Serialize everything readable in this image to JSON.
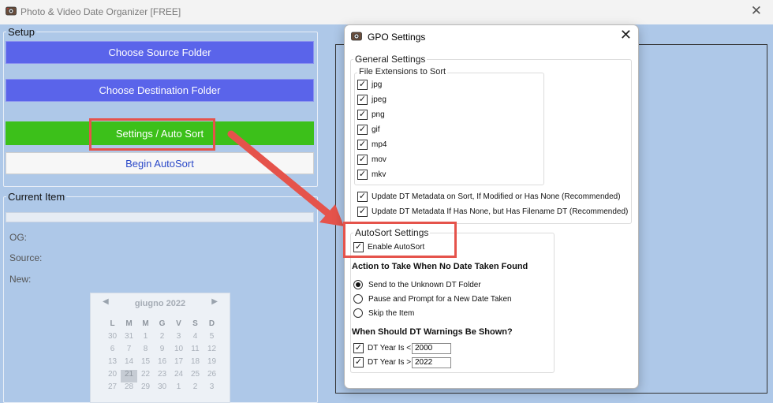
{
  "window": {
    "title": "Photo & Video Date Organizer [FREE]",
    "icon": "app-photo-icon",
    "close_glyph": "✕"
  },
  "setup": {
    "label": "Setup",
    "source_button": "Choose Source Folder",
    "destination_button": "Choose Destination Folder",
    "settings_button": "Settings / Auto Sort",
    "begin_button": "Begin AutoSort"
  },
  "current_item": {
    "label": "Current Item",
    "og_label": "OG:",
    "source_label": "Source:",
    "new_label": "New:"
  },
  "calendar": {
    "month": "giugno 2022",
    "prev": "◀",
    "next": "▶",
    "weekdays": [
      "L",
      "M",
      "M",
      "G",
      "V",
      "S",
      "D"
    ],
    "weeks": [
      [
        "30",
        "31",
        "1",
        "2",
        "3",
        "4",
        "5"
      ],
      [
        "6",
        "7",
        "8",
        "9",
        "10",
        "11",
        "12"
      ],
      [
        "13",
        "14",
        "15",
        "16",
        "17",
        "18",
        "19"
      ],
      [
        "20",
        "21",
        "22",
        "23",
        "24",
        "25",
        "26"
      ],
      [
        "27",
        "28",
        "29",
        "30",
        "1",
        "2",
        "3"
      ]
    ],
    "selected": "21"
  },
  "dialog": {
    "title": "GPO Settings",
    "close_glyph": "✕",
    "general_settings_label": "General Settings",
    "file_ext_label": "File Extensions to Sort",
    "extensions": [
      {
        "label": "jpg",
        "checked": true
      },
      {
        "label": "jpeg",
        "checked": true
      },
      {
        "label": "png",
        "checked": true
      },
      {
        "label": "gif",
        "checked": true
      },
      {
        "label": "mp4",
        "checked": true
      },
      {
        "label": "mov",
        "checked": true
      },
      {
        "label": "mkv",
        "checked": true
      }
    ],
    "update_metadata_sort": "Update DT Metadata on Sort, If Modified or Has None (Recommended)",
    "update_metadata_filename": "Update DT Metadata If Has None, but Has Filename DT (Recommended)",
    "autosort_label": "AutoSort Settings",
    "enable_autosort": "Enable AutoSort",
    "action_heading": "Action to Take When No Date Taken Found",
    "actions": [
      {
        "label": "Send to the Unknown DT Folder",
        "selected": true
      },
      {
        "label": "Pause and Prompt for a New Date Taken",
        "selected": false
      },
      {
        "label": "Skip the Item",
        "selected": false
      }
    ],
    "warnings_heading": "When Should DT Warnings Be Shown?",
    "year_less_label": "DT Year Is <",
    "year_less_value": "2000",
    "year_greater_label": "DT Year Is >",
    "year_greater_value": "2022",
    "check_glyph": "✓"
  },
  "colors": {
    "background": "#aec8e8",
    "blue_button": "#5a64ea",
    "green_button": "#3cc01a",
    "highlight_red": "#e5534b"
  }
}
